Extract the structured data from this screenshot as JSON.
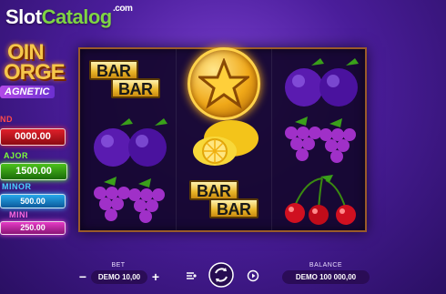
{
  "watermark": {
    "slot": "Slot",
    "catalog": "Catalog",
    "com": ".com"
  },
  "logo": {
    "line1": "OIN",
    "line2": "ORGE",
    "line3": "AGNETIC"
  },
  "jackpots": {
    "grand_label": "ND",
    "grand_value": "0000.00",
    "major_label": "AJOR",
    "major_value": "1500.00",
    "minor_label": "MINOR",
    "minor_value": "500.00",
    "mini_label": "MINI",
    "mini_value": "250.00"
  },
  "reels": [
    [
      "bar",
      "plum",
      "grapes"
    ],
    [
      "star-coin",
      "lemon",
      "bar"
    ],
    [
      "plum",
      "grapes",
      "cherry"
    ]
  ],
  "symbols": {
    "bar_text": "BAR"
  },
  "controls": {
    "bet_label": "BET",
    "bet_value": "DEMO 10,00",
    "minus": "−",
    "plus": "+",
    "balance_label": "BALANCE",
    "balance_value": "DEMO 100 000,00"
  },
  "colors": {
    "grand": "#e0202a",
    "major": "#4cc21c",
    "minor": "#26a8ea",
    "mini": "#e63cc6",
    "frame": "#9a5a2a"
  }
}
